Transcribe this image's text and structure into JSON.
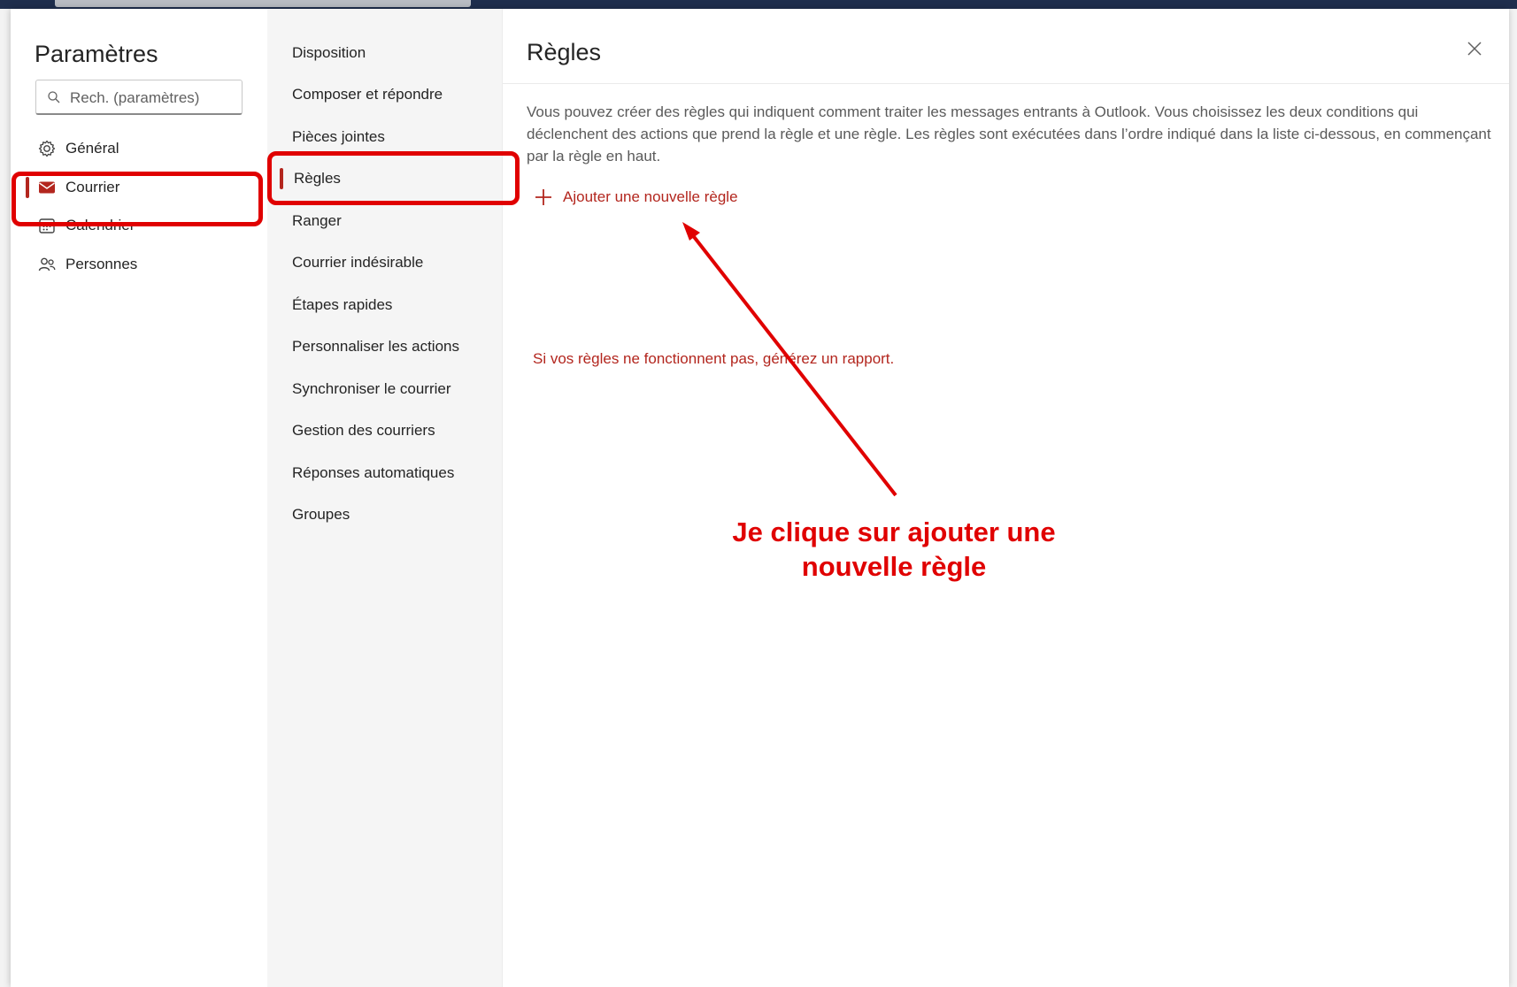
{
  "settings": {
    "title": "Paramètres",
    "search_placeholder": "Rech. (paramètres)"
  },
  "categories": [
    {
      "label": "Général",
      "icon": "gear-icon"
    },
    {
      "label": "Courrier",
      "icon": "mail-icon",
      "active": true
    },
    {
      "label": "Calendrier",
      "icon": "calendar-icon"
    },
    {
      "label": "Personnes",
      "icon": "people-icon"
    }
  ],
  "mail_submenu": [
    "Disposition",
    "Composer et répondre",
    "Pièces jointes",
    "Règles",
    "Ranger",
    "Courrier indésirable",
    "Étapes rapides",
    "Personnaliser les actions",
    "Synchroniser le courrier",
    "Gestion des courriers",
    "Réponses automatiques",
    "Groupes"
  ],
  "active_submenu": "Règles",
  "rules_page": {
    "title": "Règles",
    "description": "Vous pouvez créer des règles qui indiquent comment traiter les messages entrants à Outlook. Vous choisissez les deux conditions qui déclenchent des actions que prend la règle et une règle. Les règles sont exécutées dans l’ordre indiqué dans la liste ci-dessous, en commençant par la règle en haut.",
    "add_rule_label": "Ajouter une nouvelle règle",
    "report_link": "Si vos règles ne fonctionnent pas, générez un rapport."
  },
  "annotation": {
    "line1": "Je clique sur ajouter une",
    "line2": "nouvelle règle",
    "color": "#e00000"
  },
  "colors": {
    "accent": "#b3261e",
    "highlight": "#e00000"
  }
}
